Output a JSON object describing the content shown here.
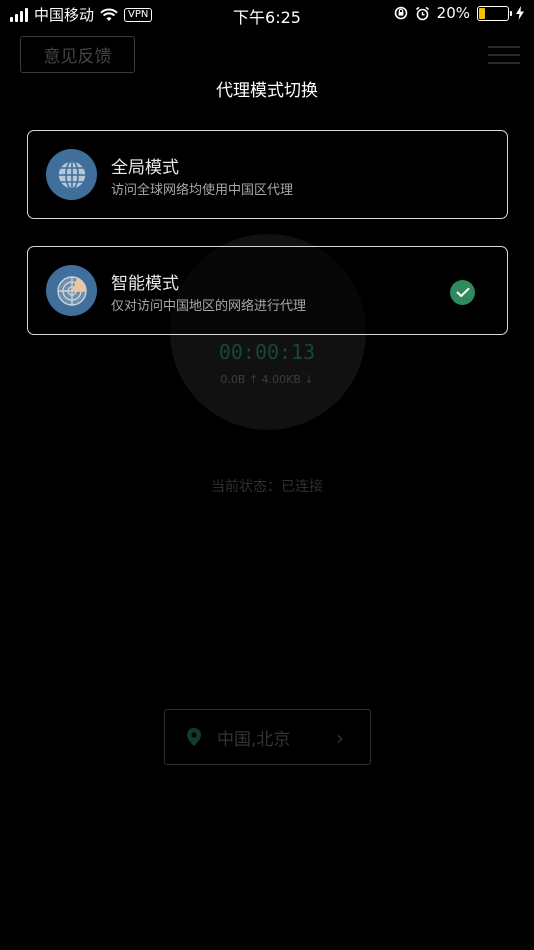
{
  "status_bar": {
    "carrier": "中国移动",
    "vpn": "VPN",
    "time": "下午6:25",
    "battery": "20%"
  },
  "background": {
    "feedback_label": "意见反馈",
    "timer": "00:00:13",
    "traffic": "0.0B ↑ 4.00KB ↓",
    "status_text": "当前状态：已连接",
    "location": "中国,北京"
  },
  "modal": {
    "title": "代理模式切换",
    "options": [
      {
        "title": "全局模式",
        "subtitle": "访问全球网络均使用中国区代理",
        "selected": false,
        "icon": "globe-icon"
      },
      {
        "title": "智能模式",
        "subtitle": "仅对访问中国地区的网络进行代理",
        "selected": true,
        "icon": "radar-icon"
      }
    ]
  },
  "colors": {
    "accent_green": "#2f8a5d",
    "icon_blue": "#3f6f9a",
    "battery_yellow": "#f2c200"
  }
}
